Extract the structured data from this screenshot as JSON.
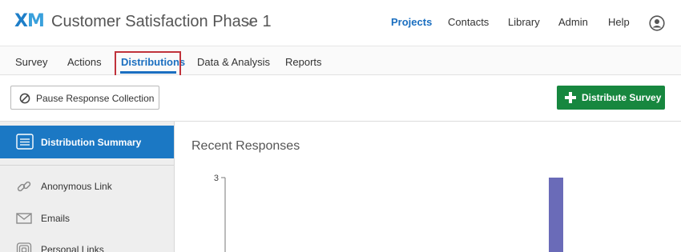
{
  "header": {
    "logo_x": "X",
    "logo_m": "M",
    "project_title": "Customer Satisfaction Phase 1",
    "nav": [
      {
        "label": "Projects",
        "active": true
      },
      {
        "label": "Contacts",
        "active": false
      },
      {
        "label": "Library",
        "active": false
      },
      {
        "label": "Admin",
        "active": false
      },
      {
        "label": "Help",
        "active": false
      }
    ],
    "icons": {
      "dropdown": "chevron-down-icon",
      "user": "user-avatar-icon"
    }
  },
  "tabs": [
    {
      "label": "Survey",
      "active": false
    },
    {
      "label": "Actions",
      "active": false
    },
    {
      "label": "Distributions",
      "active": true
    },
    {
      "label": "Data & Analysis",
      "active": false
    },
    {
      "label": "Reports",
      "active": false
    }
  ],
  "toolbar": {
    "pause_label": "Pause Response Collection",
    "distribute_label": "Distribute Survey"
  },
  "sidebar": {
    "items": [
      {
        "label": "Distribution Summary",
        "icon": "document-icon",
        "active": true
      },
      {
        "label": "Anonymous Link",
        "icon": "link-icon",
        "active": false
      },
      {
        "label": "Emails",
        "icon": "envelope-icon",
        "active": false
      },
      {
        "label": "Personal Links",
        "icon": "fingerprint-icon",
        "active": false
      }
    ]
  },
  "main": {
    "title": "Recent Responses"
  },
  "chart_data": {
    "type": "bar",
    "title": "Recent Responses",
    "ylabel": "",
    "ylim": [
      0,
      3
    ],
    "yticks": [
      3
    ],
    "series": [
      {
        "values": [
          3
        ]
      }
    ],
    "colors": {
      "bar": "#6a6bb8"
    }
  },
  "colors": {
    "accent": "#1b6fc0",
    "sidebar_active": "#1b78c4",
    "distribute_button": "#17873f",
    "highlight_box": "#c0323b"
  }
}
